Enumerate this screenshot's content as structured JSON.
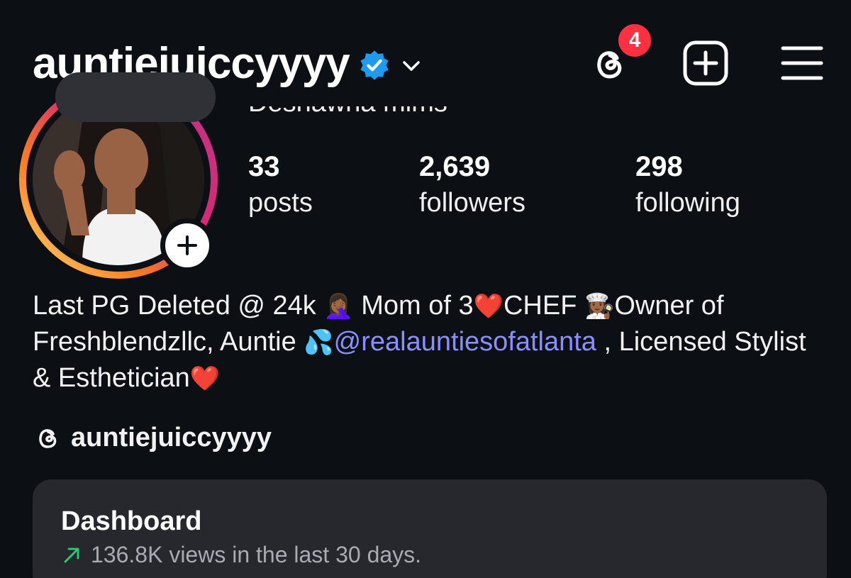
{
  "header": {
    "username": "auntiejuiccyyyy",
    "notification_count": "4"
  },
  "profile": {
    "display_name": "Deshawna mims"
  },
  "stats": [
    {
      "value": "33",
      "label": "posts"
    },
    {
      "value": "2,639",
      "label": "followers"
    },
    {
      "value": "298",
      "label": "following"
    }
  ],
  "bio": {
    "line1_a": "Last PG Deleted @ 24k ",
    "emoji_facepalm": "🤦🏾‍♀️",
    "line1_b": " Mom of 3",
    "emoji_heart": "❤️",
    "line1_c": "CHEF ",
    "emoji_chef": "👩🏾‍🍳",
    "line1_d": "Owner of Freshblendzllc, Auntie ",
    "emoji_sweat": "💦",
    "mention": "@realauntiesofatlanta",
    "line2_b": " , Licensed Stylist & Esthetician",
    "emoji_heart2": "❤️"
  },
  "threads_handle": "auntiejuiccyyyy",
  "dashboard": {
    "title": "Dashboard",
    "subtitle": "136.8K views in the last 30 days."
  },
  "colors": {
    "background": "#0c0f14",
    "badge": "#ff3040",
    "verified": "#1d9bf0",
    "mention": "#8a8fff",
    "trend_up": "#2ecc71",
    "card": "#26282e"
  }
}
